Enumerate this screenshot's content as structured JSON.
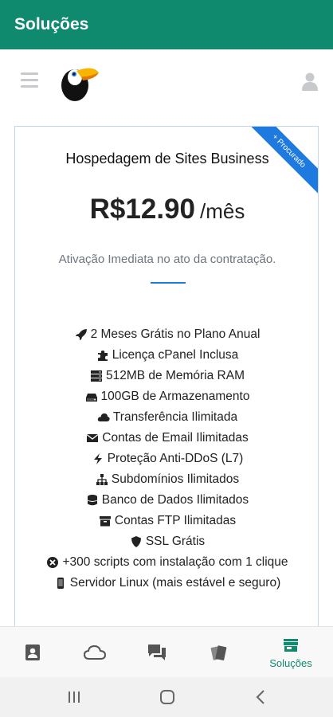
{
  "appbar": {
    "title": "Soluções"
  },
  "header": {
    "menu_icon": "menu-icon",
    "logo_icon": "toucan-logo",
    "user_icon": "user-icon"
  },
  "plan": {
    "ribbon": "+ Procurado",
    "title": "Hospedagem de Sites Business",
    "price": "R$12.90",
    "period": "/mês",
    "tagline": "Ativação Imediata no ato da contratação.",
    "features": [
      {
        "icon": "rocket-icon",
        "label": "2 Meses Grátis no Plano Anual"
      },
      {
        "icon": "puzzle-icon",
        "label": "Licença cPanel Inclusa"
      },
      {
        "icon": "server-icon",
        "label": "512MB de Memória RAM"
      },
      {
        "icon": "hdd-icon",
        "label": "100GB de Armazenamento"
      },
      {
        "icon": "cloud-icon",
        "label": "Transferência Ilimitada"
      },
      {
        "icon": "envelope-icon",
        "label": "Contas de Email Ilimitadas"
      },
      {
        "icon": "bolt-icon",
        "label": "Proteção Anti-DDoS (L7)"
      },
      {
        "icon": "sitemap-icon",
        "label": "Subdomínios Ilimitados"
      },
      {
        "icon": "database-icon",
        "label": "Banco de Dados Ilimitados"
      },
      {
        "icon": "archive-icon",
        "label": "Contas FTP Ilimitadas"
      },
      {
        "icon": "shield-icon",
        "label": "SSL Grátis"
      },
      {
        "icon": "joomla-icon",
        "label": "+300 scripts com instalação com 1 clique"
      },
      {
        "icon": "mobile-icon",
        "label": "Servidor Linux (mais estável e seguro)"
      }
    ]
  },
  "bottom_nav": {
    "items": [
      {
        "icon": "contact-card-icon",
        "label": ""
      },
      {
        "icon": "cloud-outline-icon",
        "label": ""
      },
      {
        "icon": "chat-bubbles-icon",
        "label": ""
      },
      {
        "icon": "cards-icon",
        "label": ""
      },
      {
        "icon": "store-icon",
        "label": "Soluções"
      }
    ],
    "active_color": "#0f8a6f",
    "inactive_color": "#555555"
  },
  "colors": {
    "brand": "#0f8a6f",
    "accent": "#1f7ae0"
  }
}
